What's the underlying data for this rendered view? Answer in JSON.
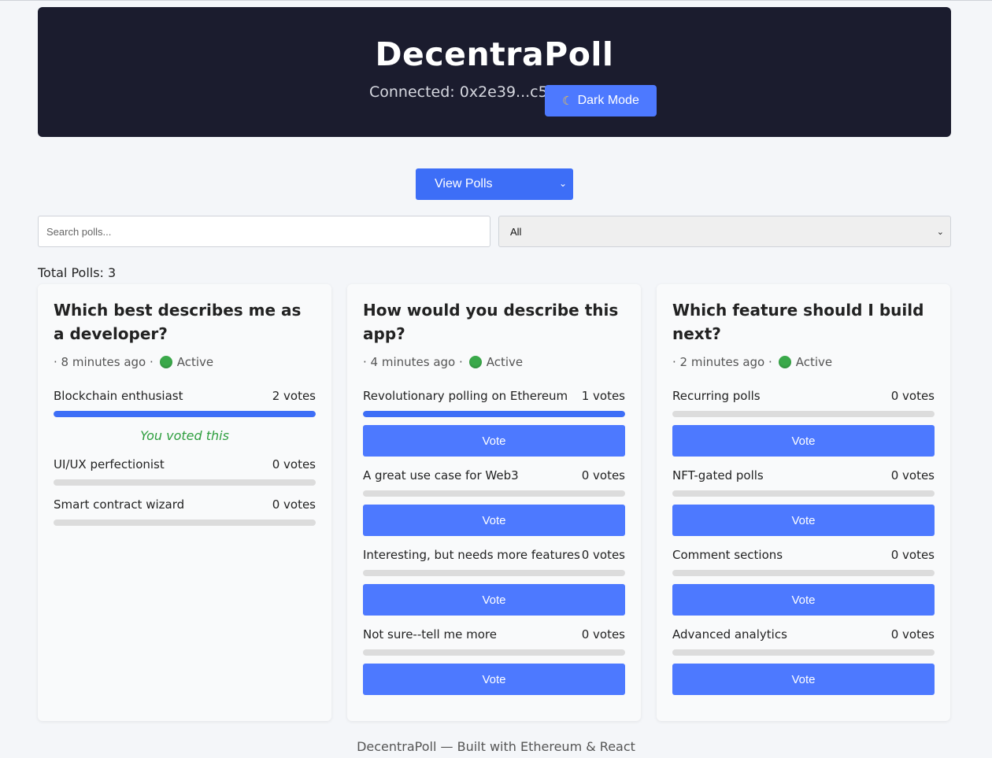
{
  "header": {
    "title": "DecentraPoll",
    "connected_text": "Connected: 0x2e39...c5b9",
    "dark_mode_label": "Dark Mode",
    "dark_mode_icon": "moon-icon"
  },
  "view_select": {
    "value": "View Polls"
  },
  "search": {
    "placeholder": "Search polls..."
  },
  "filter": {
    "value": "All"
  },
  "total_polls": "Total Polls: 3",
  "colors": {
    "accent": "#4d79ff",
    "header_bg": "#1b1c2e",
    "active": "#3aa94a",
    "voted": "#2e9e3e"
  },
  "polls": [
    {
      "title": "Which best describes me as a developer?",
      "time": "· 8 minutes ago ·",
      "status": "Active",
      "voted_text": "You voted this",
      "options": [
        {
          "label": "Blockchain enthusiast",
          "votes": "2 votes",
          "share": 1.0,
          "voted": true
        },
        {
          "label": "UI/UX perfectionist",
          "votes": "0 votes",
          "share": 0
        },
        {
          "label": "Smart contract wizard",
          "votes": "0 votes",
          "share": 0
        }
      ]
    },
    {
      "title": "How would you describe this app?",
      "time": "· 4 minutes ago ·",
      "status": "Active",
      "vote_label": "Vote",
      "options": [
        {
          "label": "Revolutionary polling on Ethereum",
          "votes": "1 votes",
          "share": 1.0
        },
        {
          "label": "A great use case for Web3",
          "votes": "0 votes",
          "share": 0
        },
        {
          "label": "Interesting, but needs more features",
          "votes": "0 votes",
          "share": 0
        },
        {
          "label": "Not sure--tell me more",
          "votes": "0 votes",
          "share": 0
        }
      ]
    },
    {
      "title": "Which feature should I build next?",
      "time": "· 2 minutes ago ·",
      "status": "Active",
      "vote_label": "Vote",
      "options": [
        {
          "label": "Recurring polls",
          "votes": "0 votes",
          "share": 0
        },
        {
          "label": "NFT-gated polls",
          "votes": "0 votes",
          "share": 0
        },
        {
          "label": "Comment sections",
          "votes": "0 votes",
          "share": 0
        },
        {
          "label": "Advanced analytics",
          "votes": "0 votes",
          "share": 0
        }
      ]
    }
  ],
  "footer": "DecentraPoll — Built with Ethereum & React"
}
